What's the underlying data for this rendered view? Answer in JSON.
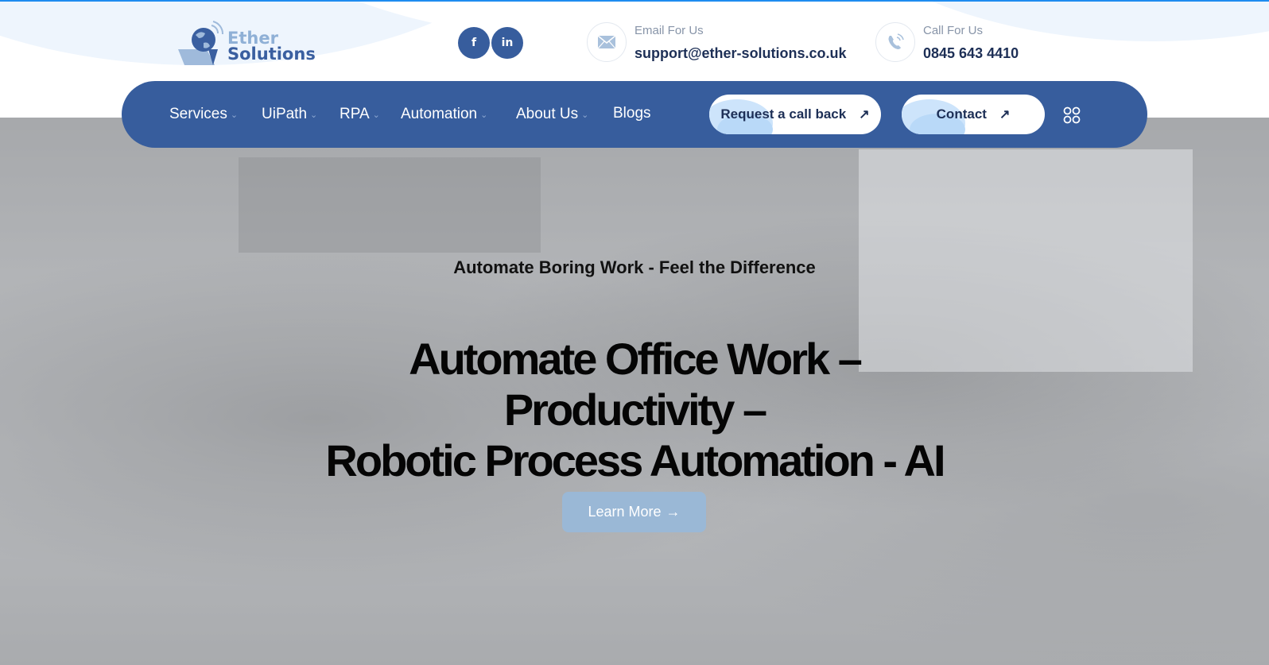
{
  "brand": {
    "name_line1": "Ether",
    "name_line2": "Solutions",
    "colors": {
      "primary": "#375d9d",
      "accent_light": "#9ab8d6",
      "dark_text": "#1d2f56",
      "top_line": "#1e8cf0"
    }
  },
  "social": [
    {
      "name": "facebook",
      "icon": "facebook-icon",
      "glyph": "f"
    },
    {
      "name": "linkedin",
      "icon": "linkedin-icon",
      "glyph": "in"
    }
  ],
  "contact": {
    "email": {
      "label": "Email For Us",
      "value": "support@ether-solutions.co.uk",
      "icon": "envelope-icon"
    },
    "phone": {
      "label": "Call For Us",
      "value": "0845 643 4410",
      "icon": "phone-icon"
    }
  },
  "nav": {
    "items": [
      {
        "label": "Services",
        "dropdown": true
      },
      {
        "label": "UiPath",
        "dropdown": true
      },
      {
        "label": "RPA",
        "dropdown": true
      },
      {
        "label": "Automation",
        "dropdown": true
      },
      {
        "label": "About Us",
        "dropdown": true
      },
      {
        "label": "Blogs",
        "dropdown": false
      }
    ],
    "chevron": "⌄",
    "buttons": {
      "callback": {
        "label": "Request a call back",
        "icon": "↗"
      },
      "contact": {
        "label": "Contact",
        "icon": "↗"
      }
    },
    "menu_icon": "grid-icon"
  },
  "hero": {
    "subtitle": "Automate Boring Work - Feel the Difference",
    "title_lines": [
      "Automate Office Work –",
      "Productivity –",
      "Robotic Process Automation - AI"
    ],
    "cta": {
      "label": "Learn More",
      "icon": "→"
    }
  }
}
